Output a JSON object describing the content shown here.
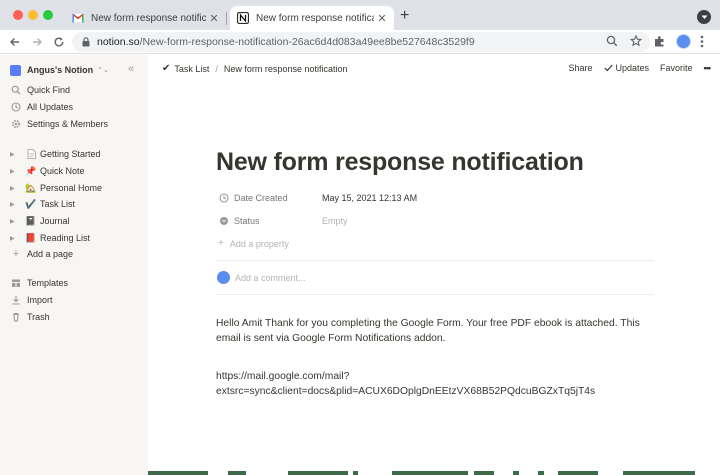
{
  "browser": {
    "tabs": [
      {
        "title": "New form response notificatio",
        "favicon": "gmail-icon",
        "active": false
      },
      {
        "title": "New form response notification",
        "favicon": "notion-icon",
        "active": true
      }
    ],
    "url": {
      "host": "notion.so",
      "path": "/New-form-response-notification-26ac6d4d083a49ee8be527648c3529f9"
    }
  },
  "sidebar": {
    "workspace": "Angus's Notion",
    "top_items": [
      {
        "label": "Quick Find",
        "icon": "search-icon"
      },
      {
        "label": "All Updates",
        "icon": "clock-icon"
      },
      {
        "label": "Settings & Members",
        "icon": "gear-icon"
      }
    ],
    "pages": [
      {
        "label": "Getting Started",
        "emoji": "📄"
      },
      {
        "label": "Quick Note",
        "emoji": "📌"
      },
      {
        "label": "Personal Home",
        "emoji": "🏡"
      },
      {
        "label": "Task List",
        "emoji": "✔️"
      },
      {
        "label": "Journal",
        "emoji": "📓"
      },
      {
        "label": "Reading List",
        "emoji": "📕"
      }
    ],
    "add_page": "Add a page",
    "bottom_items": [
      {
        "label": "Templates",
        "icon": "templates-icon"
      },
      {
        "label": "Import",
        "icon": "import-icon"
      },
      {
        "label": "Trash",
        "icon": "trash-icon"
      }
    ]
  },
  "topbar": {
    "breadcrumb": [
      "Task List",
      "New form response notification"
    ],
    "actions": {
      "share": "Share",
      "updates": "Updates",
      "favorite": "Favorite",
      "more": "•••"
    }
  },
  "page": {
    "title": "New form response notification",
    "properties": [
      {
        "name": "Date Created",
        "value": "May 15, 2021 12:13 AM",
        "icon": "clock-icon",
        "empty": false
      },
      {
        "name": "Status",
        "value": "Empty",
        "icon": "status-icon",
        "empty": true
      }
    ],
    "add_property": "Add a property",
    "comment_placeholder": "Add a comment...",
    "body": "Hello Amit Thank for you completing the Google Form. Your free PDF ebook is attached. This email is sent via Google Form Notifications addon.",
    "link_line1": "https://mail.google.com/mail?",
    "link_line2": "extsrc=sync&client=docs&plid=ACUX6DOplgDnEEtzVX68B52PQdcuBGZxTq5jT4s"
  }
}
